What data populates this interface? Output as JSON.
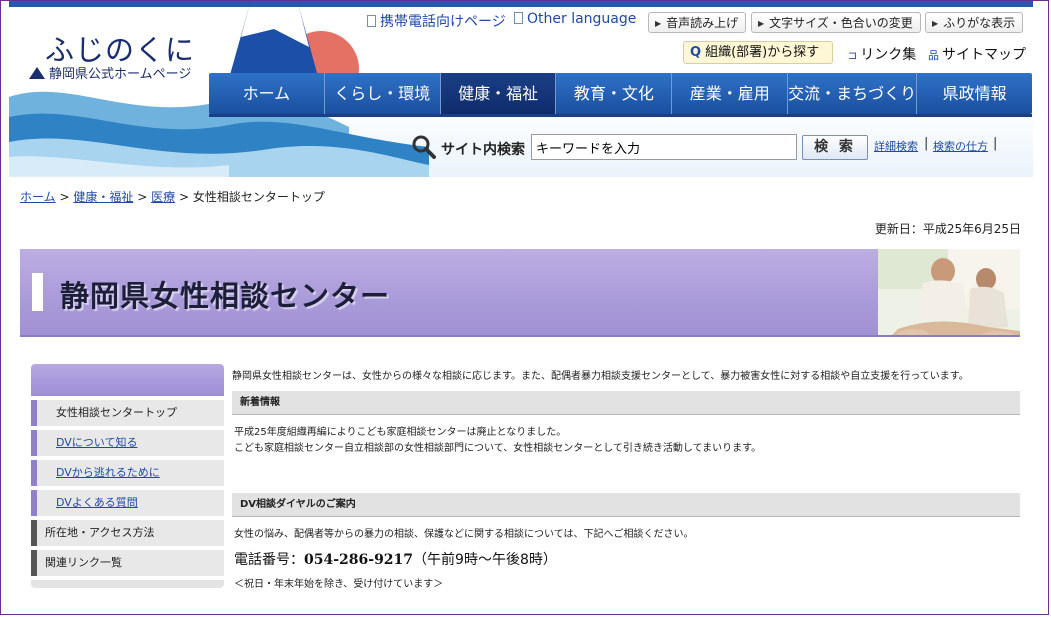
{
  "header": {
    "logo_main": "ふじのくに",
    "logo_sub": "静岡県公式ホームページ",
    "mobile_link": "携帯電話向けページ",
    "other_language": "Other language",
    "tools": [
      "音声読み上げ",
      "文字サイズ・色合いの変更",
      "ふりがな表示"
    ],
    "org_search": "組織(部署)から探す",
    "links": "リンク集",
    "sitemap": "サイトマップ"
  },
  "nav": {
    "items": [
      "ホーム",
      "くらし・環境",
      "健康・福祉",
      "教育・文化",
      "産業・雇用",
      "交流・まちづくり",
      "県政情報"
    ],
    "active_index": 2
  },
  "search": {
    "label": "サイト内検索",
    "placeholder": "キーワードを入力",
    "button": "検 索",
    "advanced": "詳細検索",
    "howto": "検索の仕方"
  },
  "breadcrumb": {
    "home": "ホーム",
    "health": "健康・福祉",
    "medical": "医療",
    "current": "女性相談センタートップ",
    "sep": ">"
  },
  "updated": "更新日：平成25年6月25日",
  "banner": {
    "title": "静岡県女性相談センター"
  },
  "sidebar": {
    "items": [
      {
        "label": "女性相談センタートップ",
        "style": "plain"
      },
      {
        "label": "DVについて知る",
        "style": "link"
      },
      {
        "label": "DVから逃れるために",
        "style": "link"
      },
      {
        "label": "DVよくある質問",
        "style": "link"
      },
      {
        "label": "所在地・アクセス方法",
        "style": "dark"
      },
      {
        "label": "関連リンク一覧",
        "style": "dark"
      }
    ]
  },
  "main": {
    "intro": "静岡県女性相談センターは、女性からの様々な相談に応じます。また、配偶者暴力相談支援センターとして、暴力被害女性に対する相談や自立支援を行っています。",
    "news_heading": "新着情報",
    "news_line1": "平成25年度組織再編によりこども家庭相談センターは廃止となりました。",
    "news_line2": "こども家庭相談センター自立相談部の女性相談部門について、女性相談センターとして引き続き活動してまいります。",
    "dv_heading": "DV相談ダイヤルのご案内",
    "dv_line": "女性の悩み、配偶者等からの暴力の相談、保護などに関する相談については、下記へご相談ください。",
    "phone_label": "電話番号：",
    "phone_number": "054-286-9217",
    "phone_hours": "（午前9時～午後8時）",
    "note": "＜祝日・年末年始を除き、受け付けています＞"
  }
}
